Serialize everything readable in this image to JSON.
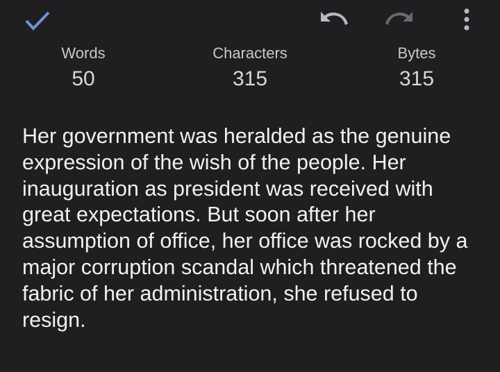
{
  "toolbar": {
    "icons": {
      "confirm": "check-icon",
      "undo": "undo-icon",
      "redo": "redo-icon",
      "more": "more-vert-icon"
    },
    "colors": {
      "accent": "#6f93d6",
      "icon_active": "#b9b9bd",
      "icon_disabled": "#6a6a6e"
    }
  },
  "stats": {
    "words": {
      "label": "Words",
      "value": "50"
    },
    "characters": {
      "label": "Characters",
      "value": "315"
    },
    "bytes": {
      "label": "Bytes",
      "value": "315"
    }
  },
  "content": {
    "text": "Her government was heralded as the genuine expression of the wish of the people. Her inauguration as president was received with great expectations. But soon after her assumption of office, her office was rocked by a major corruption scandal which threatened the fabric of her administration, she refused to resign."
  },
  "theme": {
    "background": "#1f1f22",
    "text": "#f1f1f2"
  }
}
